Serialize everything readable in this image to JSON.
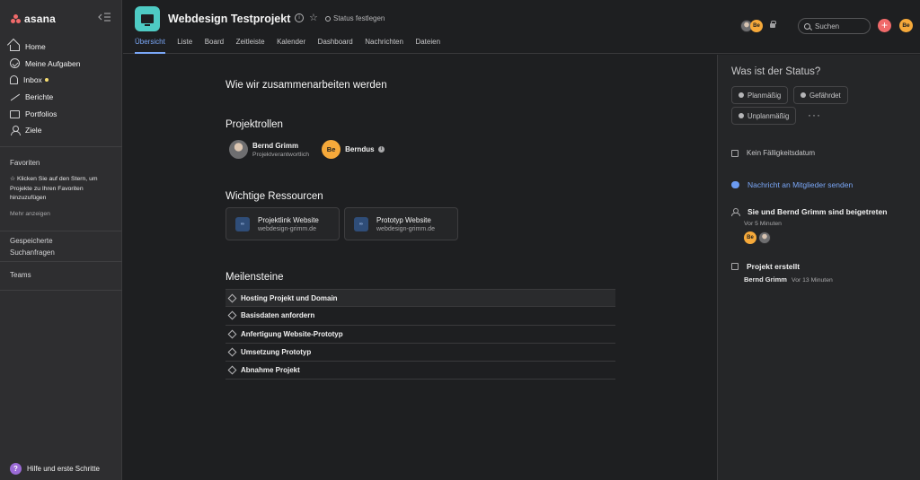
{
  "sidebar": {
    "brand": "asana",
    "nav": [
      {
        "label": "Home",
        "icon": "home-icon"
      },
      {
        "label": "Meine Aufgaben",
        "icon": "check-circle-icon"
      },
      {
        "label": "Inbox",
        "icon": "bell-icon"
      },
      {
        "label": "Berichte",
        "icon": "chart-icon"
      },
      {
        "label": "Portfolios",
        "icon": "folder-icon"
      },
      {
        "label": "Ziele",
        "icon": "person-icon"
      }
    ],
    "favorites_title": "Favoriten",
    "favorites_hint": "☆ Klicken Sie auf den Stern, um Projekte zu Ihren Favoriten hinzuzufügen",
    "show_more": "Mehr anzeigen",
    "saved_searches": "Gespeicherte Suchanfragen",
    "teams": "Teams",
    "help": "Hilfe und erste Schritte"
  },
  "header": {
    "project_title": "Webdesign Testprojekt",
    "status_link": "Status festlegen",
    "tabs": [
      "Übersicht",
      "Liste",
      "Board",
      "Zeitleiste",
      "Kalender",
      "Dashboard",
      "Nachrichten",
      "Dateien"
    ],
    "active_tab": "Übersicht",
    "member_avatar_initials": "Be",
    "search_placeholder": "Suchen",
    "user_initials": "Be",
    "brand_color": "#4ecbc4",
    "accent_color": "#7aa7f7"
  },
  "overview": {
    "intro_heading": "Wie wir zusammenarbeiten werden",
    "roles_heading": "Projektrollen",
    "roles": [
      {
        "name": "Bernd Grimm",
        "role": "Projektverantwortlich"
      },
      {
        "name": "Berndus",
        "initials": "Be"
      }
    ],
    "resources_heading": "Wichtige Ressourcen",
    "resources": [
      {
        "title": "Projektlink Website",
        "url": "webdesign-grimm.de"
      },
      {
        "title": "Prototyp Website",
        "url": "webdesign-grimm.de"
      }
    ],
    "milestones_heading": "Meilensteine",
    "milestones": [
      "Hosting Projekt und Domain",
      "Basisdaten anfordern",
      "Anfertigung Website-Prototyp",
      "Umsetzung Prototyp",
      "Abnahme Projekt"
    ]
  },
  "status_panel": {
    "title": "Was ist der Status?",
    "options": [
      "Planmäßig",
      "Gefährdet",
      "Unplanmäßig"
    ],
    "more": "···",
    "due": "Kein Fälligkeitsdatum",
    "message_link": "Nachricht an Mitglieder senden",
    "joined_title": "Sie und Bernd Grimm sind beigetreten",
    "joined_time": "Vor 5 Minuten",
    "joined_avatar_initials": "Be",
    "created_title": "Projekt erstellt",
    "created_by": "Bernd Grimm",
    "created_time": "Vor 13 Minuten"
  }
}
